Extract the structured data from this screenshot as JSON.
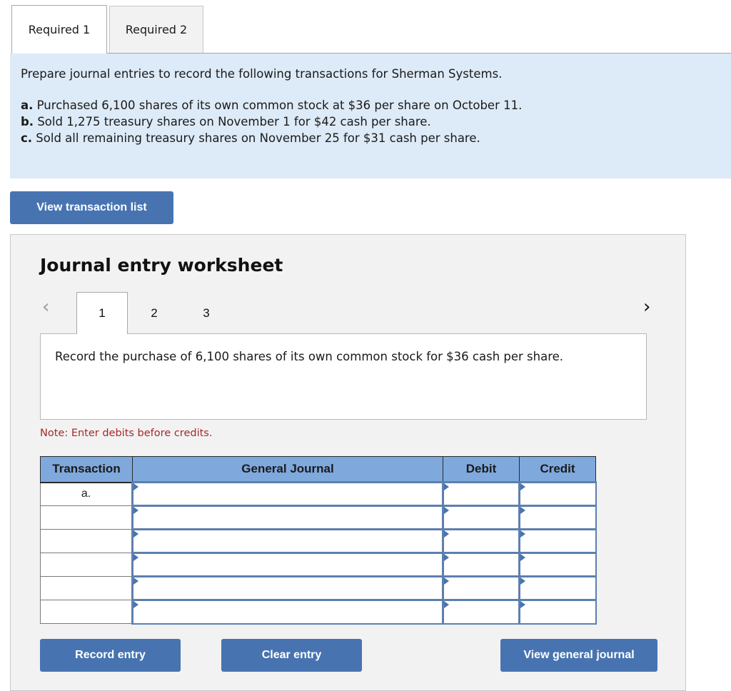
{
  "tabs": [
    {
      "label": "Required 1",
      "active": true
    },
    {
      "label": "Required 2",
      "active": false
    }
  ],
  "instructions": {
    "intro": "Prepare journal entries to record the following transactions for Sherman Systems.",
    "items": [
      {
        "letter": "a.",
        "text": " Purchased 6,100 shares of its own common stock at $36 per share on October 11."
      },
      {
        "letter": "b.",
        "text": " Sold 1,275 treasury shares on November 1 for $42 cash per share."
      },
      {
        "letter": "c.",
        "text": " Sold all remaining treasury shares on November 25 for $31 cash per share."
      }
    ]
  },
  "buttons": {
    "view_transaction_list": "View transaction list",
    "record_entry": "Record entry",
    "clear_entry": "Clear entry",
    "view_general_journal": "View general journal"
  },
  "worksheet": {
    "title": "Journal entry worksheet",
    "nav_prev": "<",
    "nav_next": ">",
    "pages": [
      "1",
      "2",
      "3"
    ],
    "active_page": "1",
    "prompt": "Record the purchase of 6,100 shares of its own common stock for $36 cash per share.",
    "note": "Note: Enter debits before credits."
  },
  "journal": {
    "headers": {
      "transaction": "Transaction",
      "general_journal": "General Journal",
      "debit": "Debit",
      "credit": "Credit"
    },
    "rows": [
      {
        "transaction": "a.",
        "account": "",
        "debit": "",
        "credit": ""
      },
      {
        "transaction": "",
        "account": "",
        "debit": "",
        "credit": ""
      },
      {
        "transaction": "",
        "account": "",
        "debit": "",
        "credit": ""
      },
      {
        "transaction": "",
        "account": "",
        "debit": "",
        "credit": ""
      },
      {
        "transaction": "",
        "account": "",
        "debit": "",
        "credit": ""
      },
      {
        "transaction": "",
        "account": "",
        "debit": "",
        "credit": ""
      }
    ]
  },
  "colors": {
    "button_bg": "#4774b1",
    "instructions_bg": "#ddeaf7",
    "table_header_bg": "#7fa9dd",
    "note_color": "#a8282a",
    "panel_bg": "#f2f2f2"
  }
}
